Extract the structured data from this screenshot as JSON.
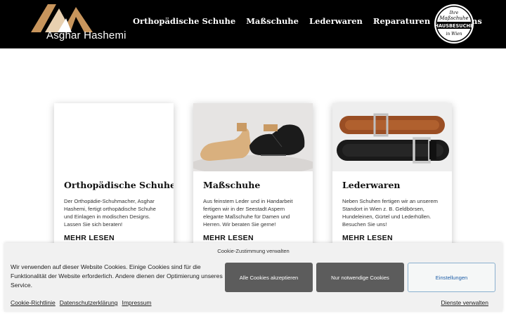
{
  "header": {
    "logo_text": "Asghar Hashemi",
    "nav": [
      {
        "label": "Orthopädische Schuhe"
      },
      {
        "label": "Maßschuhe"
      },
      {
        "label": "Lederwaren"
      },
      {
        "label": "Reparaturen"
      },
      {
        "label": "Über uns"
      }
    ],
    "badge": {
      "top": "Ihre",
      "middle_script": "Maßschuhe",
      "main": "HAUSBESUCHE",
      "bottom": "in Wien"
    }
  },
  "cards": [
    {
      "title": "Orthopädische Schuhe",
      "text": "Der Orthopädie-Schuhmacher, Asghar Hashemi, fertigt orthopädische Schuhe und Einlagen in modischen Designs. Lassen Sie sich beraten!",
      "more": "MEHR LESEN"
    },
    {
      "title": "Maßschuhe",
      "text": "Aus feinstem Leder und in Handarbeit fertigen wir in der Seestadt Aspern elegante Maßschuhe für Damen und Herren. Wir beraten Sie gerne!",
      "more": "MEHR LESEN"
    },
    {
      "title": "Lederwaren",
      "text": "Neben Schuhen fertigen wir an unserem Standort in Wien z. B. Geldbörsen, Hundeleinen, Gürtel und Lederhüllen. Besuchen Sie uns!",
      "more": "MEHR LESEN"
    }
  ],
  "cookie": {
    "heading": "Cookie-Zustimmung verwalten",
    "message": "Wir verwenden auf dieser Website Cookies. Einige Cookies sind für die Funktionalität der Website erforderlich. Andere dienen der Optimierung unseres Service.",
    "accept_label": "Alle Cookies akzeptieren",
    "necessary_label": "Nur notwendige Cookies",
    "settings_label": "Einstellungen",
    "links": [
      {
        "label": "Cookie-Richtlinie"
      },
      {
        "label": "Datenschutzerklärung"
      },
      {
        "label": "Impressum"
      }
    ],
    "services_label": "Dienste verwalten"
  },
  "colors": {
    "header_bg": "#000000",
    "logo_accent": "#c8955c",
    "button_dark": "#5c5c5c",
    "settings_text": "#1f5fa8"
  }
}
